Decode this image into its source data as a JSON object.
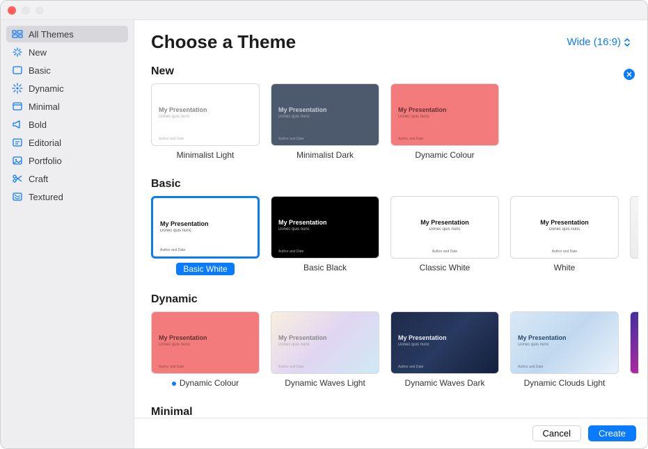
{
  "header": {
    "title": "Choose a Theme",
    "aspect_label": "Wide (16:9)"
  },
  "sidebar": {
    "items": [
      {
        "label": "All Themes",
        "icon": "grid"
      },
      {
        "label": "New",
        "icon": "sparkle"
      },
      {
        "label": "Basic",
        "icon": "square"
      },
      {
        "label": "Dynamic",
        "icon": "burst"
      },
      {
        "label": "Minimal",
        "icon": "window"
      },
      {
        "label": "Bold",
        "icon": "megaphone"
      },
      {
        "label": "Editorial",
        "icon": "text"
      },
      {
        "label": "Portfolio",
        "icon": "image"
      },
      {
        "label": "Craft",
        "icon": "scissors"
      },
      {
        "label": "Textured",
        "icon": "texture"
      }
    ],
    "selected_index": 0
  },
  "sections": [
    {
      "title": "New",
      "closable": true,
      "themes": [
        {
          "label": "Minimalist Light",
          "bg": "#ffffff",
          "fg": "#8a8a8e",
          "title": "My Presentation",
          "sub": "Donec quis nunc"
        },
        {
          "label": "Minimalist Dark",
          "bg": "#4d5a6e",
          "fg": "#c7ccd4",
          "title": "My Presentation",
          "sub": "Donec quis nunc"
        },
        {
          "label": "Dynamic Colour",
          "bg": "#f37b7b",
          "fg": "#62332f",
          "title": "My Presentation",
          "sub": "Donec quis nunc"
        }
      ]
    },
    {
      "title": "Basic",
      "themes": [
        {
          "label": "Basic White",
          "bg": "#ffffff",
          "fg": "#111111",
          "title": "My Presentation",
          "sub": "Donec quis nunc",
          "selected": true,
          "pill": true
        },
        {
          "label": "Basic Black",
          "bg": "#000000",
          "fg": "#ffffff",
          "title": "My Presentation",
          "sub": "Donec quis nunc"
        },
        {
          "label": "Classic White",
          "bg": "#ffffff",
          "fg": "#111111",
          "title": "My Presentation",
          "sub": "Donec quis nunc",
          "centered": true
        },
        {
          "label": "White",
          "bg": "#ffffff",
          "fg": "#111111",
          "title": "My Presentation",
          "sub": "Donec quis nunc",
          "centered": true
        }
      ],
      "peek": true
    },
    {
      "title": "Dynamic",
      "themes": [
        {
          "label": "Dynamic Colour",
          "bg": "#f37b7b",
          "fg": "#62332f",
          "title": "My Presentation",
          "sub": "Donec quis nunc",
          "dot": true
        },
        {
          "label": "Dynamic Waves Light",
          "bg": "linear-gradient(135deg,#fbeedf,#e0d6f2,#cfe9f5)",
          "fg": "#8a8a8e",
          "title": "My Presentation",
          "sub": "Donec quis nunc"
        },
        {
          "label": "Dynamic Waves Dark",
          "bg": "linear-gradient(135deg,#1f2a4a,#283a60,#14203c)",
          "fg": "#e8ecf4",
          "title": "My Presentation",
          "sub": "Donec quis nunc"
        },
        {
          "label": "Dynamic Clouds Light",
          "bg": "linear-gradient(135deg,#d8e9f7,#c0d8ef,#e9f2fa)",
          "fg": "#2b4a6a",
          "title": "My Presentation",
          "sub": "Donec quis nunc"
        }
      ],
      "peek": "dk"
    },
    {
      "title": "Minimal",
      "themes": []
    }
  ],
  "footer": {
    "cancel": "Cancel",
    "create": "Create"
  },
  "thumb_author": "Author and Date"
}
